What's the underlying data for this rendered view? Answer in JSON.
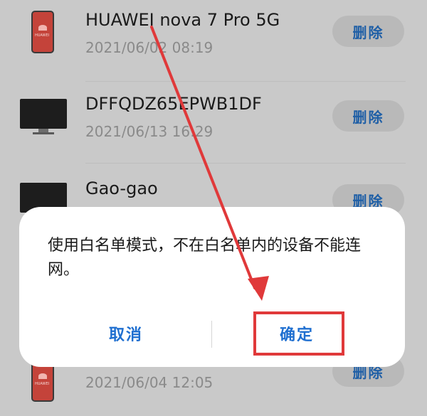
{
  "devices": [
    {
      "name": "HUAWEI nova 7 Pro 5G",
      "time": "2021/06/02 08:19",
      "delete_label": "删除",
      "icon": "phone-icon",
      "brand": "HUAWEI"
    },
    {
      "name": "DFFQDZ65EPWB1DF",
      "time": "2021/06/13 16:29",
      "delete_label": "删除",
      "icon": "monitor-icon"
    },
    {
      "name": "Gao-gao",
      "time": "",
      "delete_label": "删除",
      "icon": "monitor-icon"
    },
    {
      "name": "",
      "time": "2021/06/04 12:05",
      "delete_label": "删除",
      "icon": "phone-icon",
      "brand": "HUAWEI"
    }
  ],
  "dialog": {
    "message": "使用白名单模式，不在白名单内的设备不能连网。",
    "cancel_label": "取消",
    "confirm_label": "确定"
  },
  "colors": {
    "annotation": "#e0393a",
    "accent": "#1f6fd0"
  }
}
